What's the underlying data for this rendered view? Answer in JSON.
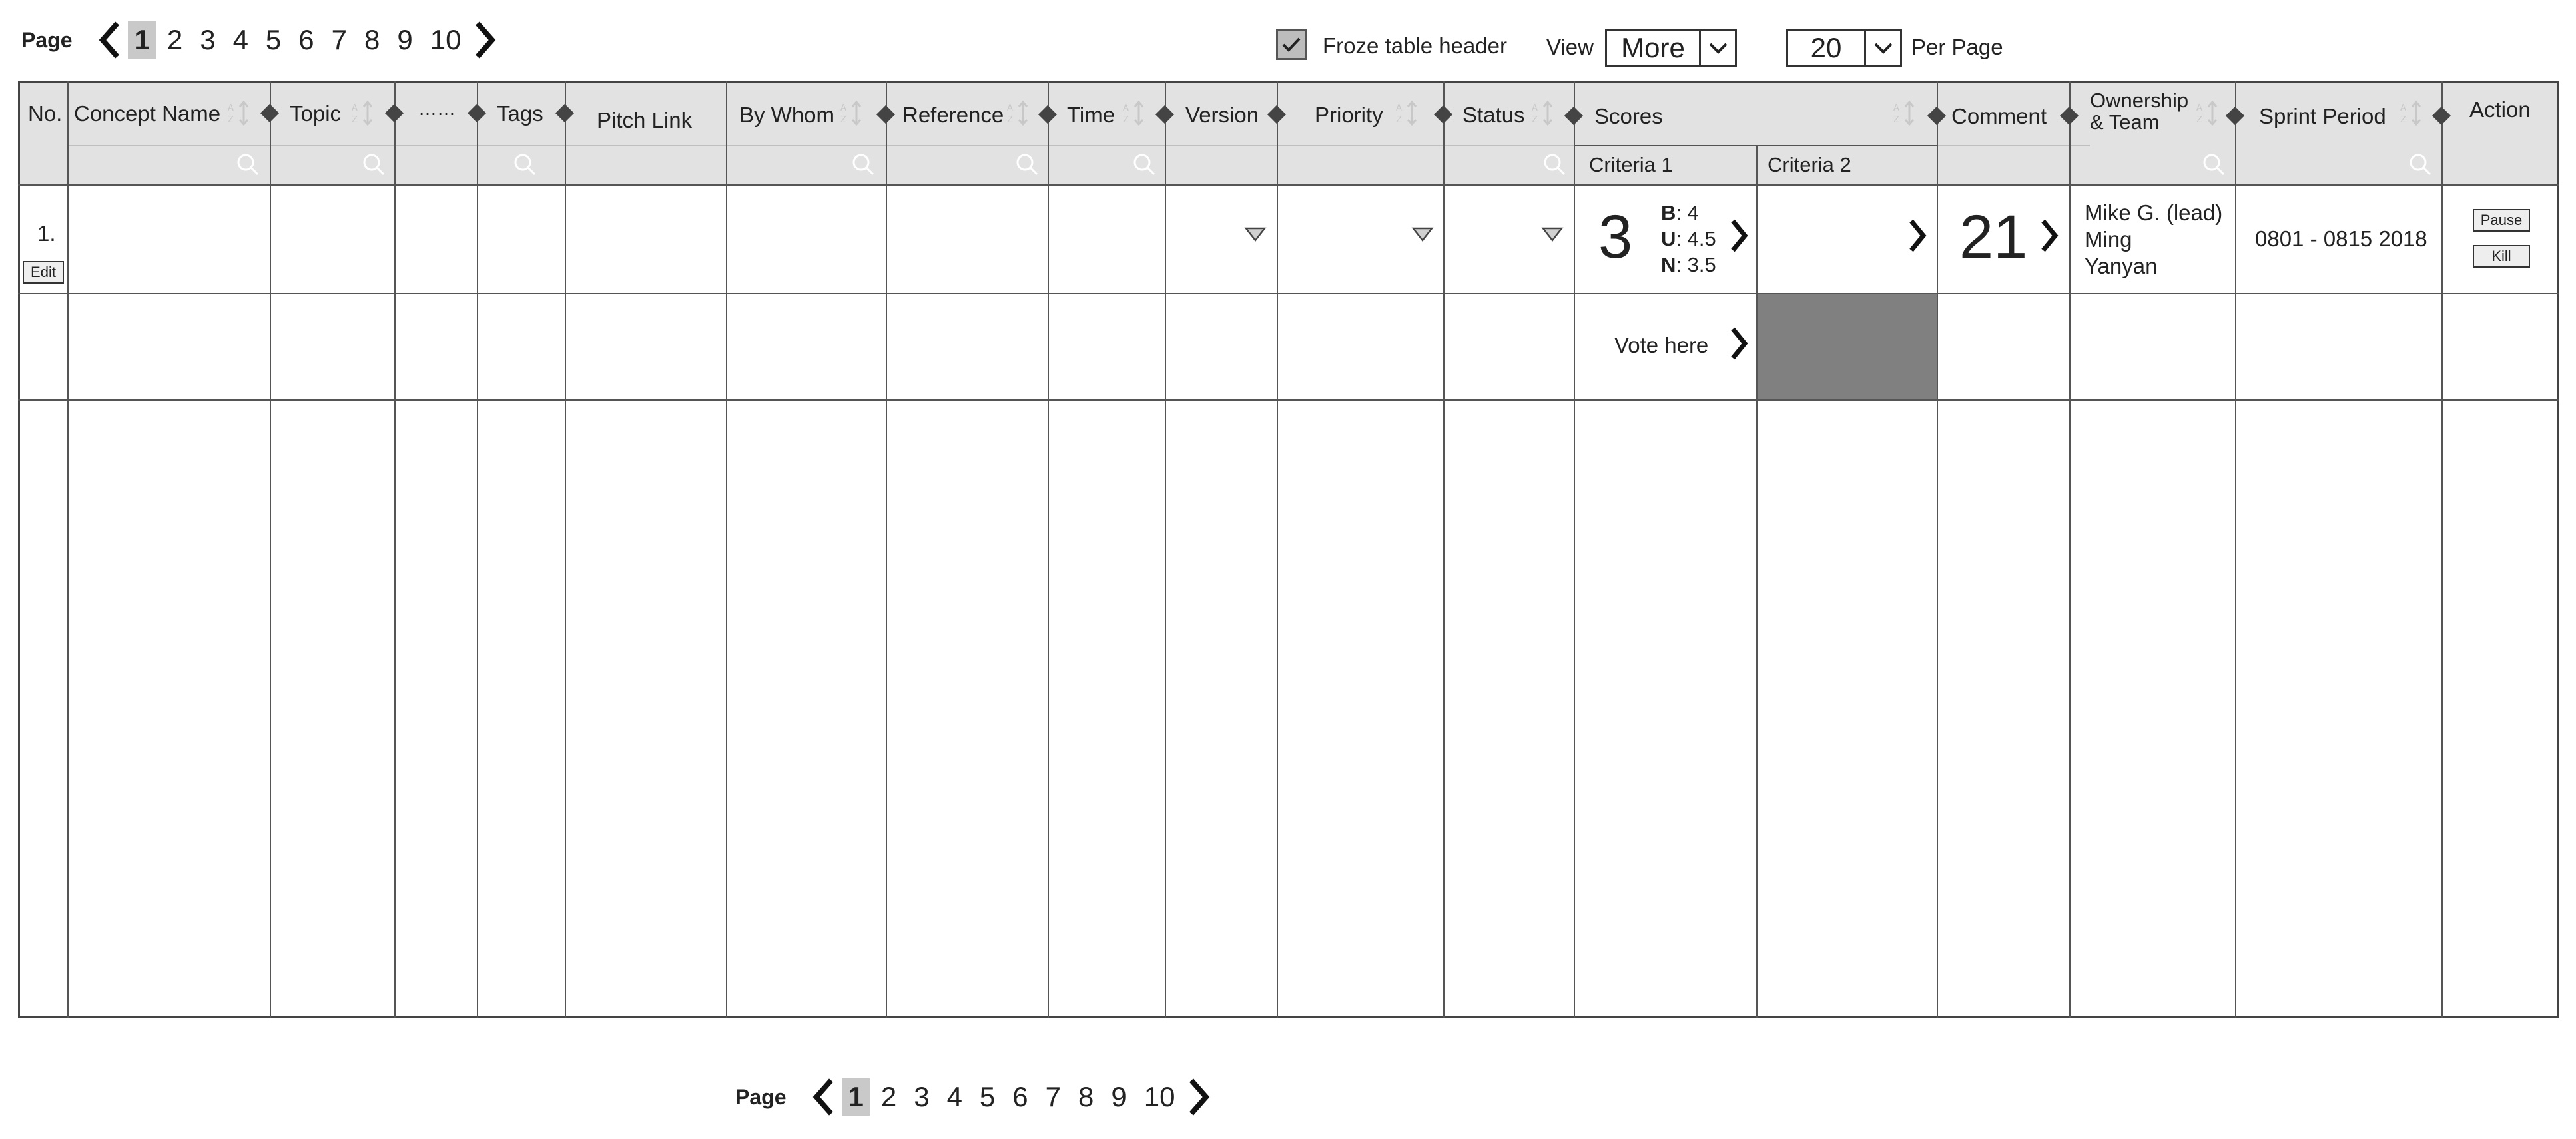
{
  "pagination": {
    "label": "Page",
    "pages": [
      "1",
      "2",
      "3",
      "4",
      "5",
      "6",
      "7",
      "8",
      "9",
      "10"
    ],
    "current": "1"
  },
  "controls": {
    "freeze_label": "Froze table header",
    "freeze_checked": true,
    "view_label": "View",
    "view_value": "More",
    "per_page_value": "20",
    "per_page_label": "Per Page"
  },
  "columns": {
    "no": "No.",
    "concept_name": "Concept Name",
    "topic": "Topic",
    "more": "……",
    "tags": "Tags",
    "pitch_link": "Pitch Link",
    "by_whom": "By Whom",
    "reference": "Reference",
    "time": "Time",
    "version": "Version",
    "priority": "Priority",
    "status": "Status",
    "scores": "Scores",
    "criteria1": "Criteria 1",
    "criteria2": "Criteria 2",
    "comment": "Comment",
    "ownership_line1": "Ownership",
    "ownership_line2": "& Team",
    "sprint_period": "Sprint Period",
    "action": "Action"
  },
  "row1": {
    "no": "1.",
    "edit_label": "Edit",
    "score_total": "3",
    "score_b_label": "B",
    "score_b": ": 4",
    "score_u_label": "U",
    "score_u": ": 4.5",
    "score_n_label": "N",
    "score_n": ": 3.5",
    "comment_count": "21",
    "owners": [
      "Mike G. (lead)",
      "Ming",
      "Yanyan"
    ],
    "sprint_period": "0801 - 0815 2018",
    "pause_label": "Pause",
    "kill_label": "Kill"
  },
  "row2": {
    "vote_label": "Vote here"
  }
}
